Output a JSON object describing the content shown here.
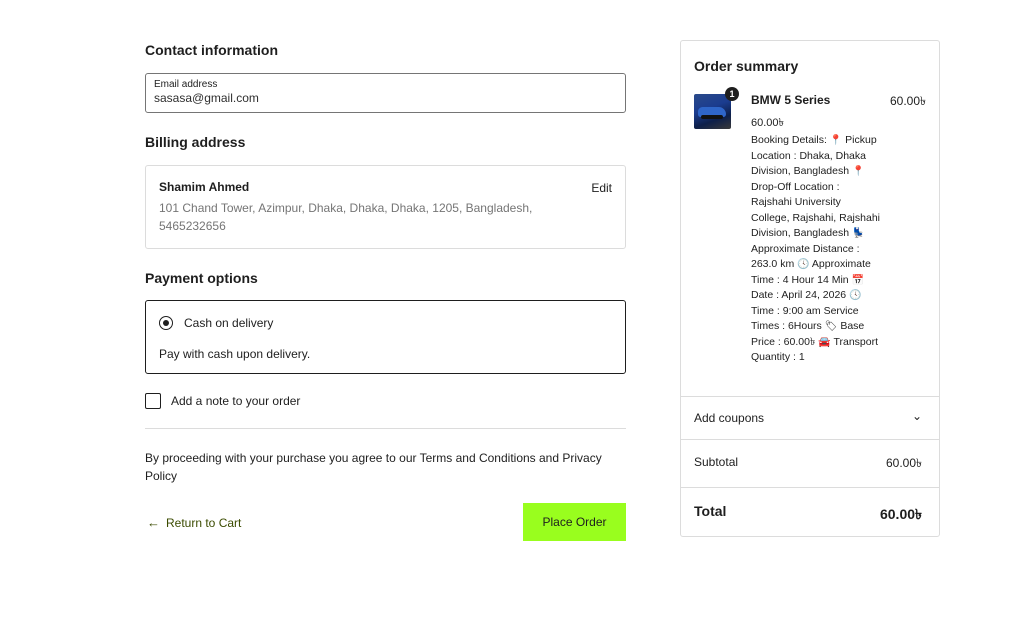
{
  "contact": {
    "title": "Contact information",
    "email_label": "Email address",
    "email_value": "sasasa@gmail.com"
  },
  "billing": {
    "title": "Billing address",
    "name": "Shamim Ahmed",
    "edit_label": "Edit",
    "address": "101 Chand Tower, Azimpur, Dhaka, Dhaka, Dhaka, 1205, Bangladesh, 5465232656"
  },
  "payment": {
    "title": "Payment options",
    "option_label": "Cash on delivery",
    "option_description": "Pay with cash upon delivery."
  },
  "note": {
    "label": "Add a note to your order"
  },
  "terms": {
    "text": "By proceeding with your purchase you agree to our Terms and Conditions and Privacy Policy"
  },
  "actions": {
    "return_label": "Return to Cart",
    "place_order_label": "Place Order"
  },
  "summary": {
    "title": "Order summary",
    "item": {
      "quantity": "1",
      "name": "BMW 5 Series",
      "price_right": "60.00৳",
      "price": "60.00৳",
      "details": {
        "booking_details": "Booking Details:",
        "pickup_location": "Pickup Location : Dhaka, Dhaka Division, Bangladesh",
        "dropoff_location": "Drop-Off Location : Rajshahi University College, Rajshahi, Rajshahi Division, Bangladesh",
        "approx_distance": "Approximate Distance : 263.0 km",
        "approx_time": "Approximate Time : 4 Hour 14 Min",
        "date": "Date : April 24, 2026",
        "time": "Time : 9:00 am",
        "service_times": "Service Times : 6Hours",
        "base_price": "Base Price : 60.00৳",
        "transport_quantity": "Transport Quantity : 1"
      }
    },
    "coupons_label": "Add coupons",
    "subtotal_label": "Subtotal",
    "subtotal_value": "60.00৳",
    "total_label": "Total",
    "total_value": "60.00৳"
  },
  "icons": {
    "location": "map-pin-icon",
    "transmission": "seat-icon",
    "clock": "clock-icon",
    "calendar": "calendar-icon",
    "tag": "tag-icon",
    "car": "car-icon",
    "return": "arrow-left-icon",
    "chevron": "chevron-down-icon"
  },
  "colors": {
    "accent": "#99fe1e",
    "return_link": "#3b4b00"
  }
}
